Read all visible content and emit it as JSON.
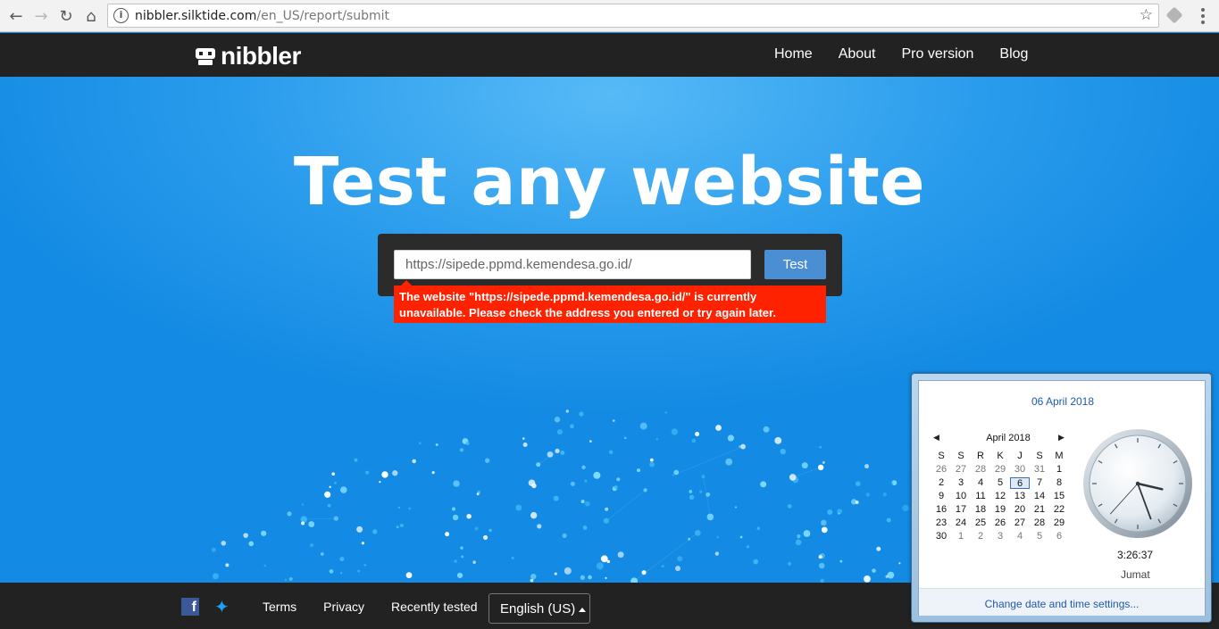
{
  "browser": {
    "url_host": "nibbler.silktide.com",
    "url_path": "/en_US/report/submit",
    "icons": [
      "back-arrow-icon",
      "forward-arrow-icon",
      "reload-icon",
      "home-icon",
      "info-icon",
      "star-icon",
      "extension-icon",
      "menu-icon"
    ]
  },
  "site": {
    "logo_text": "nibbler",
    "nav": [
      "Home",
      "About",
      "Pro version",
      "Blog"
    ]
  },
  "hero": {
    "title": "Test any website",
    "input_value": "https://sipede.ppmd.kemendesa.go.id/",
    "test_button": "Test",
    "error_line1": "The website \"https://sipede.ppmd.kemendesa.go.id/\" is currently",
    "error_line2": "unavailable. Please check the address you entered or try again later."
  },
  "footer": {
    "links": [
      "Terms",
      "Privacy",
      "Recently tested"
    ],
    "language": "English (US)"
  },
  "clock": {
    "full_date": "06 April 2018",
    "month_label": "April 2018",
    "weekdays": [
      "S",
      "S",
      "R",
      "K",
      "J",
      "S",
      "M"
    ],
    "days": [
      [
        "26",
        "27",
        "28",
        "29",
        "30",
        "31",
        "1"
      ],
      [
        "2",
        "3",
        "4",
        "5",
        "6",
        "7",
        "8"
      ],
      [
        "9",
        "10",
        "11",
        "12",
        "13",
        "14",
        "15"
      ],
      [
        "16",
        "17",
        "18",
        "19",
        "20",
        "21",
        "22"
      ],
      [
        "23",
        "24",
        "25",
        "26",
        "27",
        "28",
        "29"
      ],
      [
        "30",
        "1",
        "2",
        "3",
        "4",
        "5",
        "6"
      ]
    ],
    "today": "6",
    "time": "3:26:37",
    "day_name": "Jumat",
    "settings_link": "Change date and time settings..."
  },
  "colors": {
    "header_bg": "#222222",
    "hero_blue": "#2a9cec",
    "error_red": "#ff2200",
    "button_blue": "#4a8fd4"
  }
}
